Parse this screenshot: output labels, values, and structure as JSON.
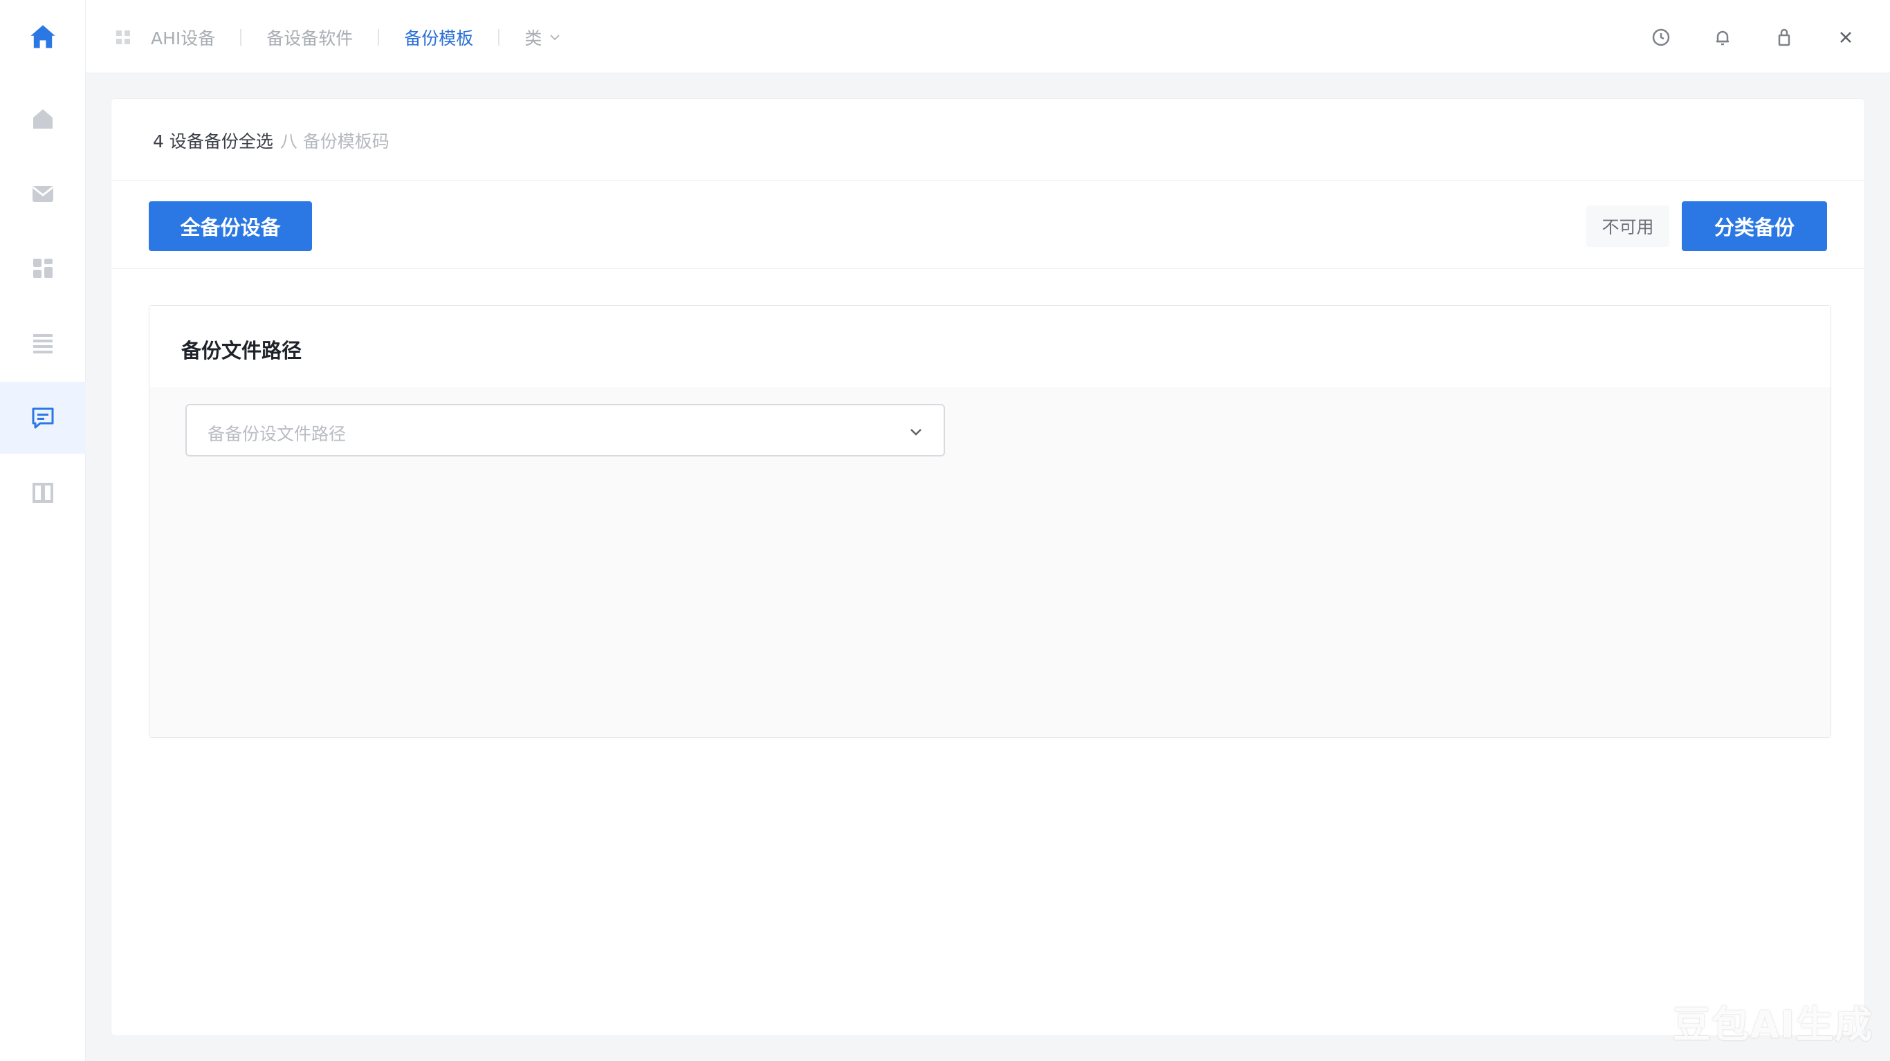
{
  "sidebar": {
    "items": [
      {
        "name": "home",
        "icon": "home-icon"
      },
      {
        "name": "mail",
        "icon": "envelope-icon"
      },
      {
        "name": "apps",
        "icon": "grid-blocks-icon"
      },
      {
        "name": "list",
        "icon": "list-icon"
      },
      {
        "name": "message",
        "icon": "message-icon",
        "active": true
      },
      {
        "name": "book",
        "icon": "book-icon"
      }
    ],
    "accent": "#2b78e4"
  },
  "breadcrumb": {
    "items": [
      "AHI设备",
      "备设备软件",
      "备份模板"
    ],
    "more_label": "类",
    "active_index": 2,
    "active_color": "#2b6fd6"
  },
  "top_actions": [
    {
      "name": "clock",
      "icon": "clock-icon"
    },
    {
      "name": "notifications",
      "icon": "bell-icon"
    },
    {
      "name": "lock",
      "icon": "lock-icon"
    },
    {
      "name": "close",
      "icon": "close-icon"
    }
  ],
  "panel": {
    "title": "4 设备备份全选",
    "subtitle": "八 备份模板码"
  },
  "toolbar": {
    "full_backup_label": "全备份设备",
    "disabled_label": "不可用",
    "category_backup_label": "分类备份"
  },
  "card": {
    "title": "备份文件路径",
    "select_placeholder": "备备份设文件路径"
  },
  "watermark": "豆包AI生成",
  "colors": {
    "primary": "#2b78e4",
    "background": "#f4f5f7",
    "panel": "#ffffff"
  }
}
